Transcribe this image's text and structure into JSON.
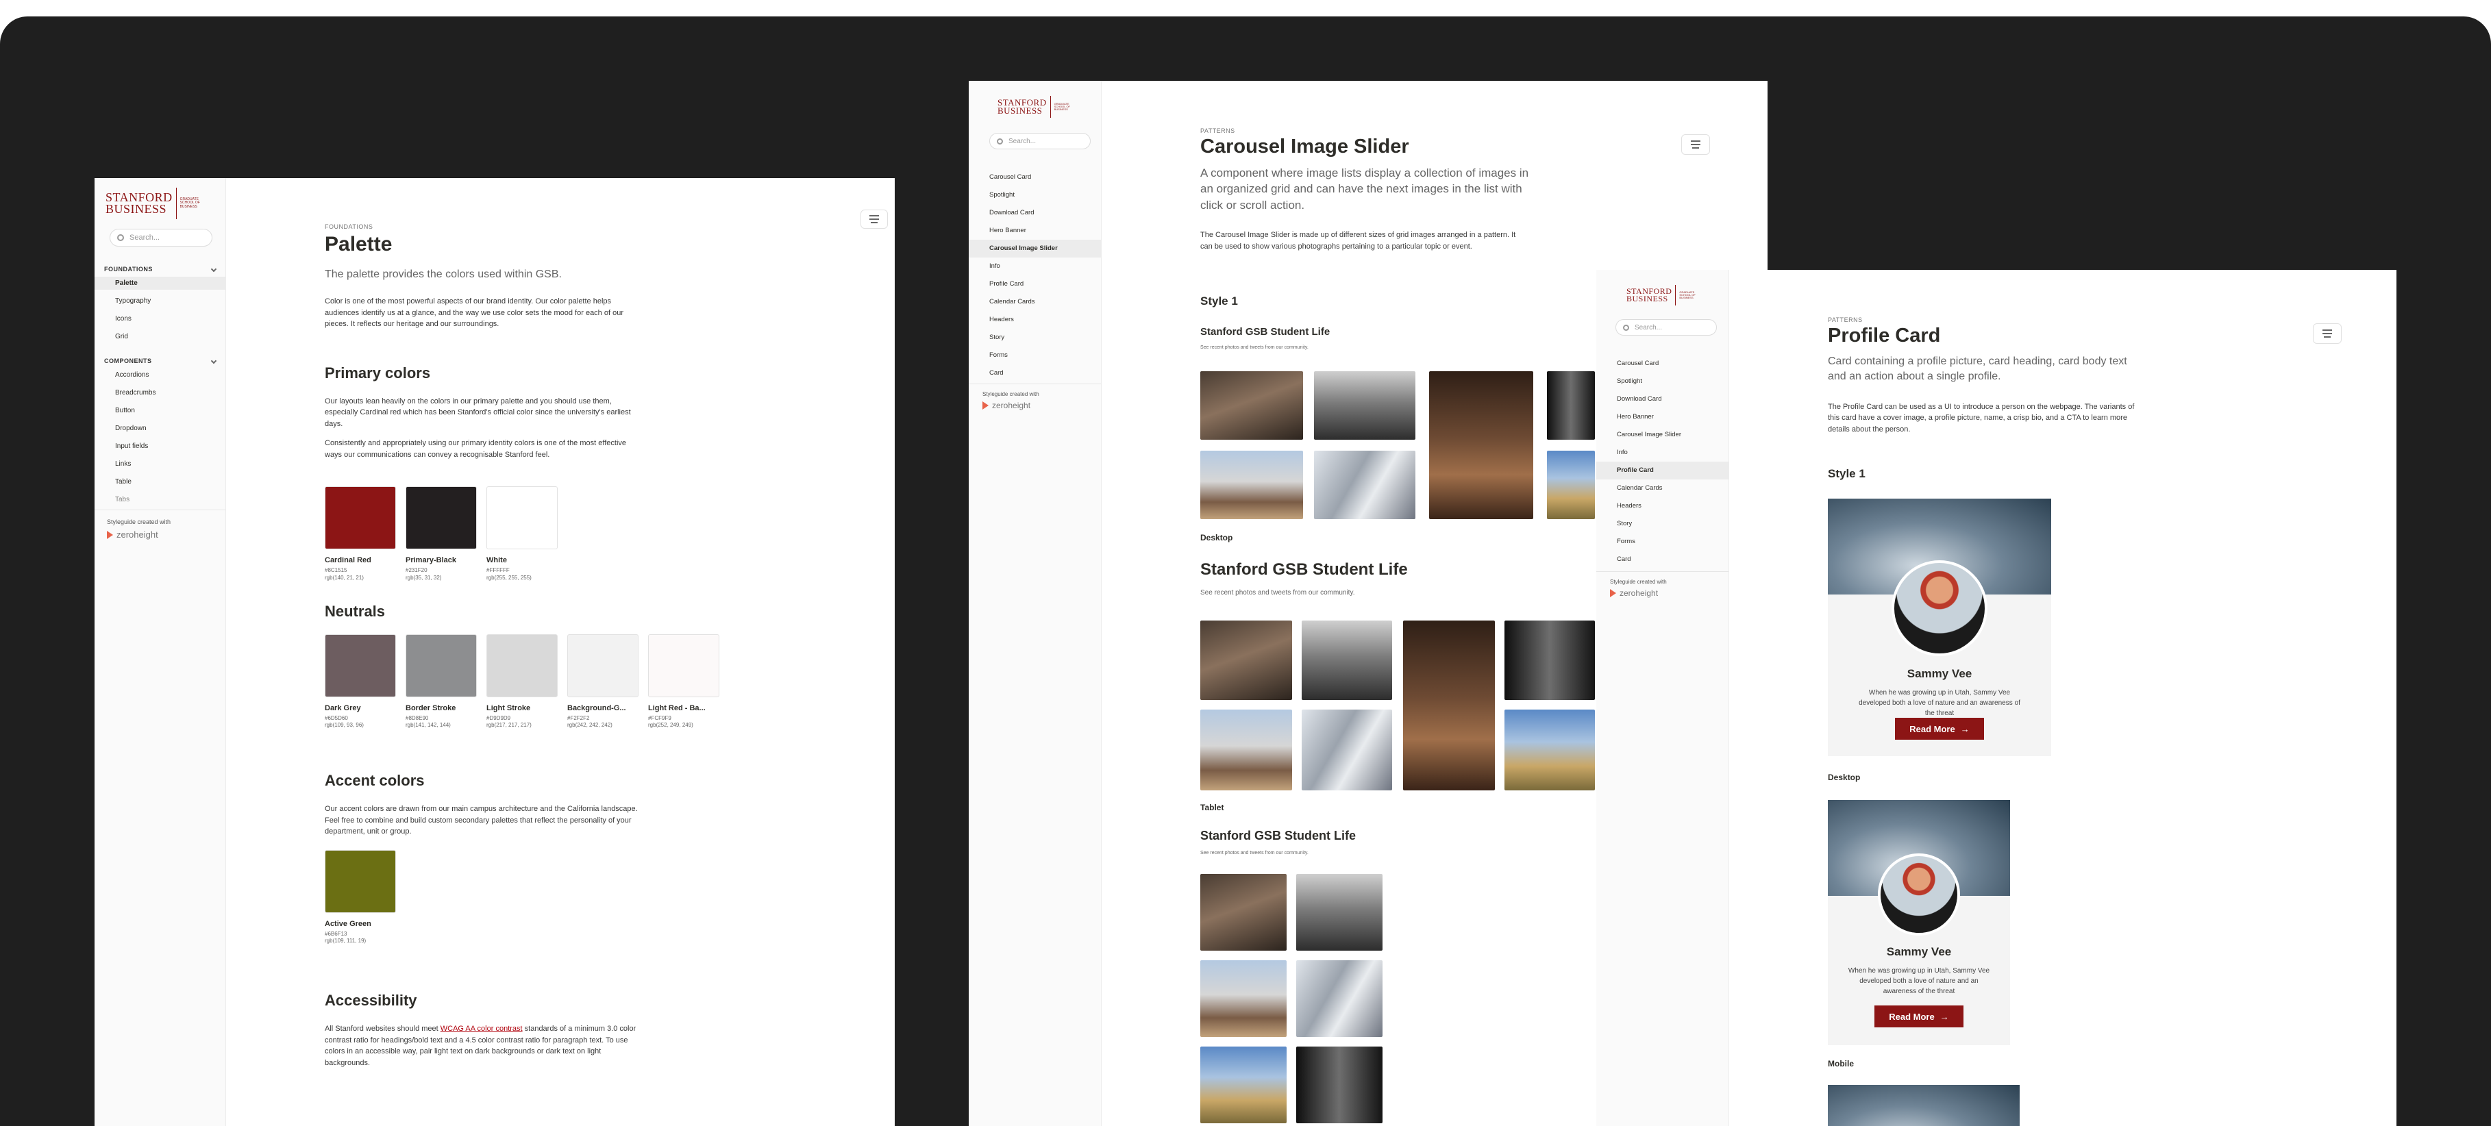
{
  "colors": {
    "accent": "#8C1515",
    "background": "#1F1F1F"
  },
  "search_placeholder": "Search...",
  "credit": {
    "text": "Styleguide created with",
    "brand": "zeroheight"
  },
  "logo": {
    "line1": "STANFORD",
    "line2": "BUSINESS",
    "sub1": "GRADUATE",
    "sub2": "SCHOOL OF",
    "sub3": "BUSINESS"
  },
  "palette_page": {
    "nav_groups": [
      {
        "label": "FOUNDATIONS",
        "items": [
          "Palette",
          "Typography",
          "Icons",
          "Grid"
        ],
        "active": 0
      },
      {
        "label": "COMPONENTS",
        "items": [
          "Accordions",
          "Breadcrumbs",
          "Button",
          "Dropdown",
          "Input fields",
          "Links",
          "Table",
          "Tabs"
        ],
        "active": -1
      }
    ],
    "eyebrow": "FOUNDATIONS",
    "title": "Palette",
    "lead": "The palette provides the colors used within GSB.",
    "intro": "Color is one of the most powerful aspects of our brand identity. Our color palette helps audiences identify us at a glance, and the way we use color sets the mood for each of our pieces. It reflects our heritage and our surroundings.",
    "primary_heading": "Primary colors",
    "primary_p1": "Our layouts lean heavily on the colors in our primary palette and you should use them, especially Cardinal red which has been Stanford's official color since the university's earliest days.",
    "primary_p2": "Consistently and appropriately using our primary identity colors is one of the most effective ways our communications can convey a recognisable Stanford feel.",
    "primary_swatches": [
      {
        "name": "Cardinal Red",
        "hex": "#8C1515",
        "rgb": "rgb(140, 21, 21)",
        "color": "#8C1515"
      },
      {
        "name": "Primary-Black",
        "hex": "#231F20",
        "rgb": "rgb(35, 31, 32)",
        "color": "#231F20"
      },
      {
        "name": "White",
        "hex": "#FFFFFF",
        "rgb": "rgb(255, 255, 255)",
        "color": "#FFFFFF"
      }
    ],
    "neutrals_heading": "Neutrals",
    "neutral_swatches": [
      {
        "name": "Dark Grey",
        "hex": "#6D5D60",
        "rgb": "rgb(109, 93, 96)",
        "color": "#6D5D60"
      },
      {
        "name": "Border Stroke",
        "hex": "#8D8E90",
        "rgb": "rgb(141, 142, 144)",
        "color": "#8D8E90"
      },
      {
        "name": "Light Stroke",
        "hex": "#D9D9D9",
        "rgb": "rgb(217, 217, 217)",
        "color": "#D9D9D9"
      },
      {
        "name": "Background-G...",
        "hex": "#F2F2F2",
        "rgb": "rgb(242, 242, 242)",
        "color": "#F2F2F2"
      },
      {
        "name": "Light Red - Ba...",
        "hex": "#FCF9F9",
        "rgb": "rgb(252, 249, 249)",
        "color": "#FCF9F9"
      }
    ],
    "accent_heading": "Accent colors",
    "accent_p": "Our accent colors are drawn from our main campus architecture and the California landscape. Feel free to combine and build custom secondary palettes that reflect the personality of your department, unit or group.",
    "accent_swatches": [
      {
        "name": "Active Green",
        "hex": "#6B6F13",
        "rgb": "rgb(109, 111, 19)",
        "color": "#6B6F13"
      }
    ],
    "accessibility_heading": "Accessibility",
    "access_p_before": "All Stanford websites should meet ",
    "access_link": "WCAG AA color contrast",
    "access_p_after": " standards of a minimum 3.0 color contrast ratio for headings/bold text and a 4.5 color contrast ratio for paragraph text. To use colors in an accessible way, pair light text on dark backgrounds or dark text on light backgrounds."
  },
  "pattern_nav": [
    "Carousel Card",
    "Spotlight",
    "Download Card",
    "Hero Banner",
    "Carousel Image Slider",
    "Info",
    "Profile Card",
    "Calendar Cards",
    "Headers",
    "Story",
    "Forms",
    "Card"
  ],
  "carousel_page": {
    "active": 4,
    "eyebrow": "PATTERNS",
    "title": "Carousel Image Slider",
    "lead": "A component where image lists display a collection of images in an organized grid and can have the next images in the list with click or scroll action.",
    "para": "The Carousel Image Slider is made up of different sizes of grid images arranged in a pattern. It can be used to show various photographs pertaining to a particular topic or event.",
    "style_label": "Style 1",
    "gallery_title": "Stanford GSB Student Life",
    "gallery_sub": "See recent photos and tweets from our community.",
    "desktop_label": "Desktop",
    "tablet_label": "Tablet"
  },
  "profile_page": {
    "active": 6,
    "eyebrow": "PATTERNS",
    "title": "Profile Card",
    "lead": "Card containing a profile picture, card heading, card body text and an action about a single profile.",
    "para": "The Profile Card can be used as a UI to introduce a person on the webpage. The variants of this card have a cover image, a profile picture, name, a crisp bio, and a CTA to learn more details about the person.",
    "style_label": "Style 1",
    "card_name": "Sammy Vee",
    "card_bio": "When he was growing up in Utah, Sammy Vee developed both a love of nature and an awareness of the threat",
    "cta_label": "Read More",
    "cta_arrow": "→",
    "desktop_label": "Desktop",
    "mobile_label": "Mobile"
  }
}
